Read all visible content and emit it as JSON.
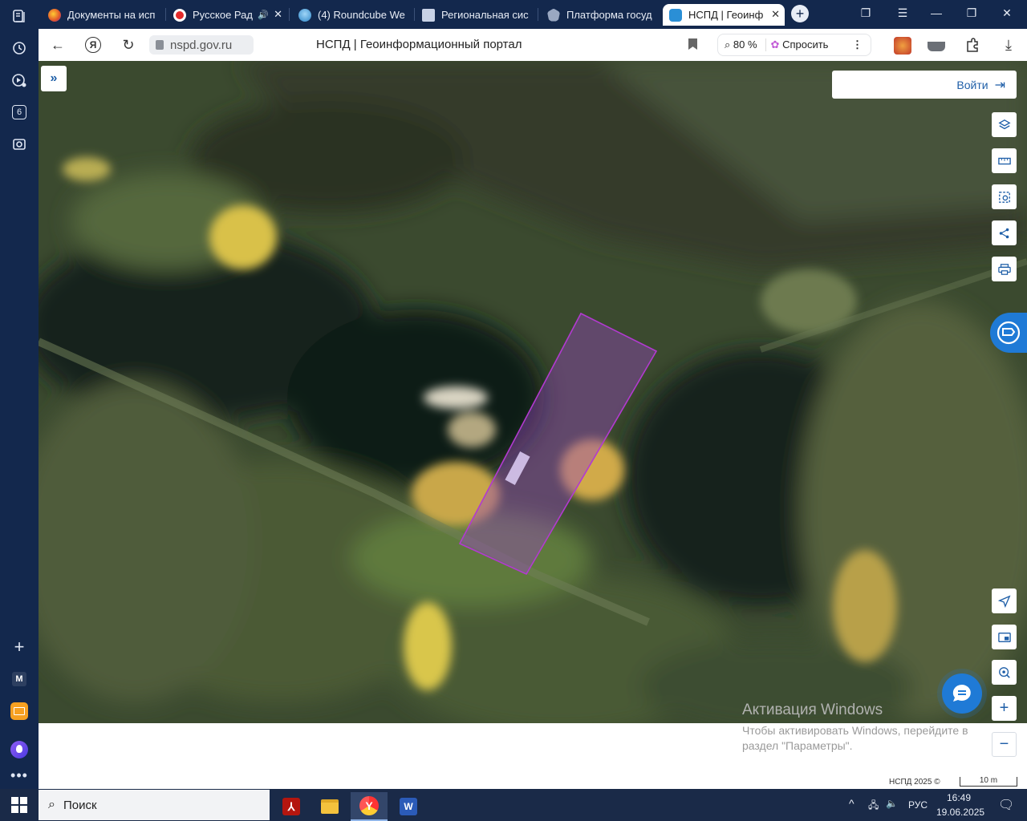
{
  "browser": {
    "tabs": [
      {
        "label": "Документы на исп",
        "icon": "firefox-like-icon",
        "color": "#e0552a"
      },
      {
        "label": "Русское Рад",
        "icon": "radio-icon",
        "color": "#e32b2b",
        "audio_icon": "speaker-icon"
      },
      {
        "label": "(4) Roundcube We",
        "icon": "roundcube-icon",
        "color": "#4aa3df"
      },
      {
        "label": "Региональная сис",
        "icon": "page-icon",
        "color": "#c8d2e6"
      },
      {
        "label": "Платформа госуд",
        "icon": "emblem-icon",
        "color": "#9aa8c2"
      },
      {
        "label": "НСПД | Геоинф",
        "icon": "nspd-icon",
        "color": "#2a8fd6",
        "active": true
      }
    ],
    "url": "nspd.gov.ru",
    "page_title": "НСПД | Геоинформационный портал",
    "zoom": "80 %",
    "ask_label": "Спросить"
  },
  "sidebar": {
    "tab_count_badge": "6",
    "mail_label": "M"
  },
  "map": {
    "login_label": "Войти",
    "tools": [
      "layers-icon",
      "ruler-icon",
      "select-area-icon",
      "share-icon",
      "print-icon"
    ],
    "nav_tools": [
      "locate-icon",
      "minimap-icon",
      "search-location-icon",
      "zoom-in-icon",
      "zoom-out-icon"
    ],
    "zoom_in": "+",
    "zoom_out": "−",
    "copyright": "НСПД 2025 ©",
    "scale_label": "10 m",
    "parcel_color": "#b23ad0"
  },
  "windows": {
    "activate_title": "Активация Windows",
    "activate_text": "Чтобы активировать Windows, перейдите в раздел \"Параметры\"."
  },
  "taskbar": {
    "search_label": "Поиск",
    "language": "РУС",
    "time": "16:49",
    "date": "19.06.2025",
    "apps": [
      "pdf-app-icon",
      "file-explorer-icon",
      "yandex-browser-icon",
      "word-icon"
    ]
  }
}
